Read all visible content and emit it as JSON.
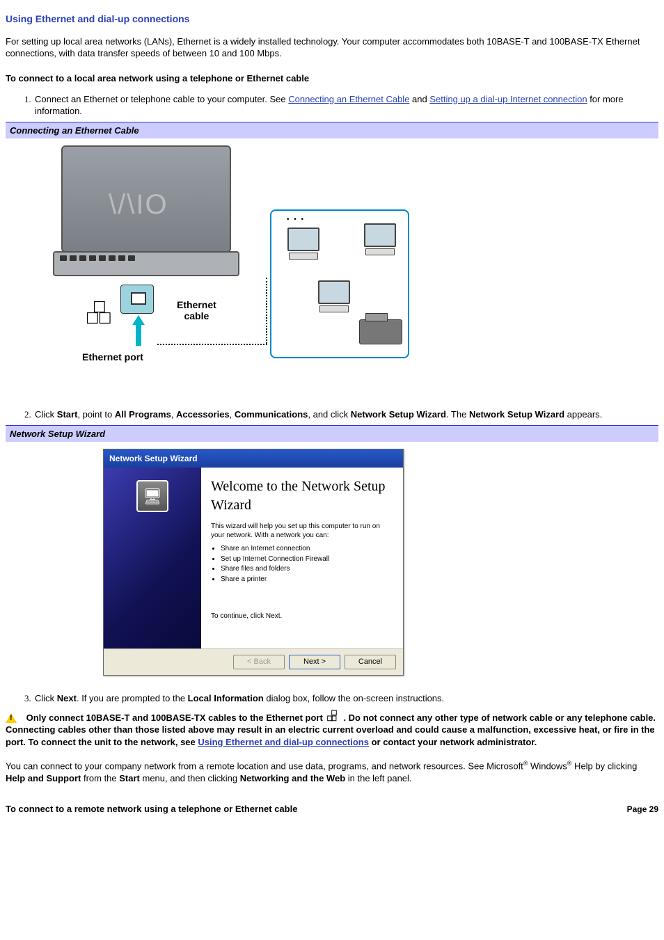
{
  "title": "Using Ethernet and dial-up connections",
  "intro": "For setting up local area networks (LANs), Ethernet is a widely installed technology. Your computer accommodates both 10BASE-T and 100BASE-TX Ethernet connections, with data transfer speeds of between 10 and 100 Mbps.",
  "subhead1": "To connect to a local area network using a telephone or Ethernet cable",
  "step1_a": "Connect an Ethernet or telephone cable to your computer. See ",
  "step1_link1": "Connecting an Ethernet Cable",
  "step1_mid": " and ",
  "step1_link2": "Setting up a dial-up Internet connection",
  "step1_b": " for more information.",
  "caption1": "Connecting an Ethernet Cable",
  "fig1_vaio": "\\/\\IO",
  "fig1_eth_cable": "Ethernet",
  "fig1_eth_cable2": "cable",
  "fig1_eth_port": "Ethernet port",
  "step2_a": "Click ",
  "step2_b1": "Start",
  "step2_c": ", point to ",
  "step2_b2": "All Programs",
  "step2_d": ", ",
  "step2_b3": "Accessories",
  "step2_e": ", ",
  "step2_b4": "Communications",
  "step2_f": ", and click ",
  "step2_b5": "Network Setup Wizard",
  "step2_g": ". The ",
  "step2_b6": "Network Setup Wizard",
  "step2_h": " appears.",
  "caption2": "Network Setup Wizard",
  "wizard": {
    "titlebar": "Network Setup Wizard",
    "heading": "Welcome to the Network Setup Wizard",
    "desc": "This wizard will help you set up this computer to run on your network. With a network you can:",
    "bullets": [
      "Share an Internet connection",
      "Set up Internet Connection Firewall",
      "Share files and folders",
      "Share a printer"
    ],
    "continue": "To continue, click Next.",
    "back": "< Back",
    "next": "Next >",
    "cancel": "Cancel"
  },
  "step3_a": "Click ",
  "step3_b1": "Next",
  "step3_b": ". If you are prompted to the ",
  "step3_b2": "Local Information",
  "step3_c": " dialog box, follow the on-screen instructions.",
  "warn_a": "Only connect 10BASE-T and 100BASE-TX cables to the Ethernet port ",
  "warn_b": ". Do not connect any other type of network cable or any telephone cable. Connecting cables other than those listed above may result in an electric current overload and could cause a malfunction, excessive heat, or fire in the port. To connect the unit to the network, see ",
  "warn_link": "Using Ethernet and dial-up connections",
  "warn_c": " or contact your network administrator.",
  "remote_a": "You can connect to your company network from a remote location and use data, programs, and network resources. See Microsoft",
  "remote_b": " Windows",
  "remote_c": " Help by clicking ",
  "remote_b1": "Help and Support",
  "remote_d": " from the ",
  "remote_b2": "Start",
  "remote_e": " menu, and then clicking ",
  "remote_b3": "Networking and the Web",
  "remote_f": " in the left panel.",
  "subhead2": "To connect to a remote network using a telephone or Ethernet cable",
  "page_label": "Page 29",
  "reg": "®"
}
